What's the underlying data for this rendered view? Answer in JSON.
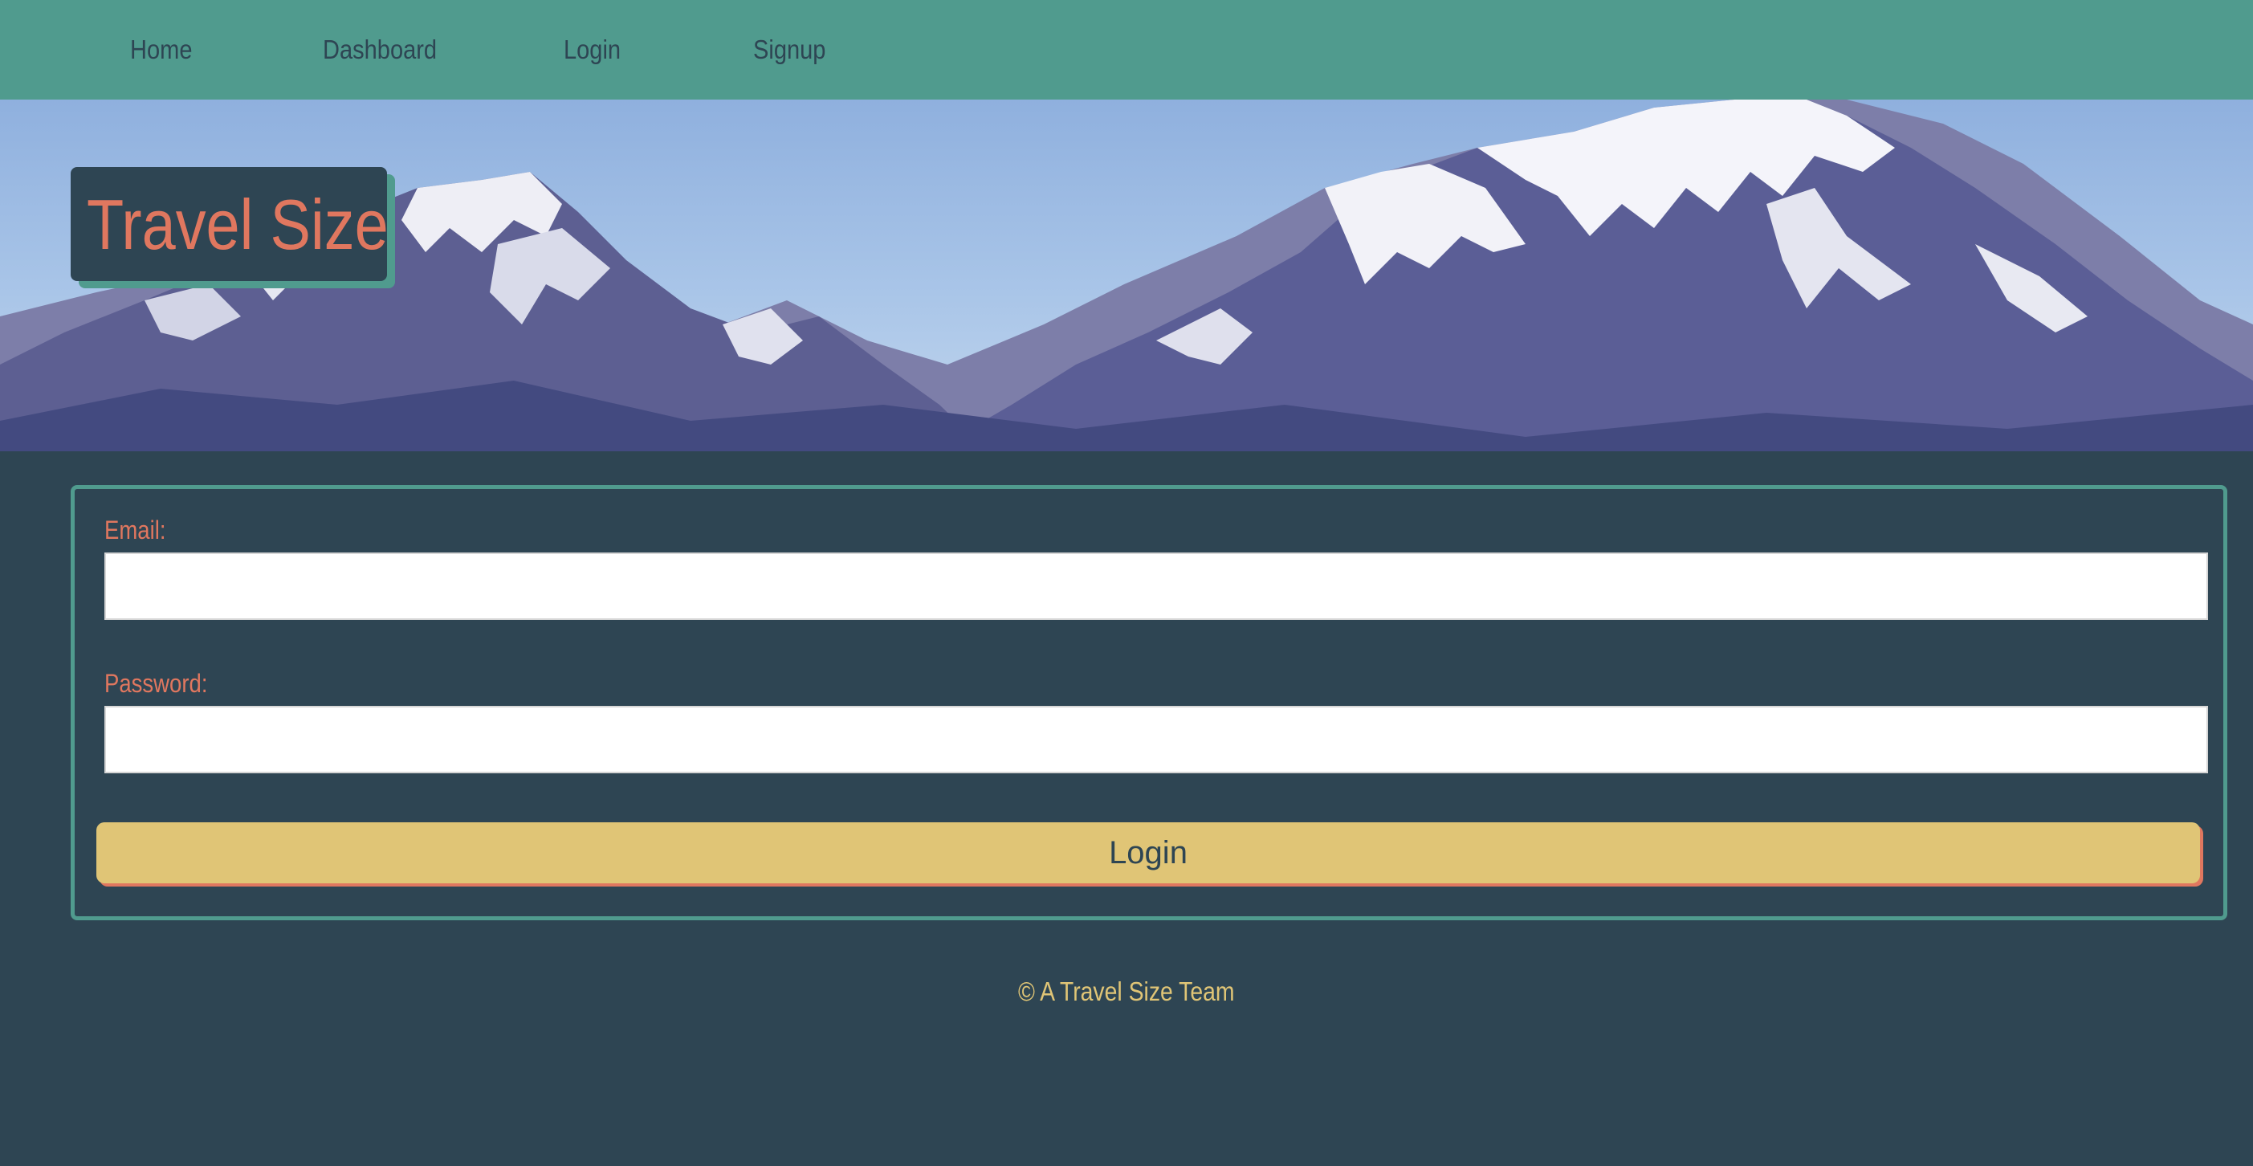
{
  "nav": {
    "items": [
      {
        "label": "Home"
      },
      {
        "label": "Dashboard"
      },
      {
        "label": "Login"
      },
      {
        "label": "Signup"
      }
    ]
  },
  "header": {
    "brand": "Travel Size"
  },
  "form": {
    "email_label": "Email:",
    "email_value": "",
    "password_label": "Password:",
    "password_value": "",
    "submit_label": "Login"
  },
  "footer": {
    "text": "© A Travel Size Team"
  },
  "colors": {
    "nav_bg": "#509b8e",
    "page_bg": "#2e4553",
    "brand_text": "#e0775f",
    "button_bg": "#e0c576",
    "footer_text": "#e0c576"
  }
}
